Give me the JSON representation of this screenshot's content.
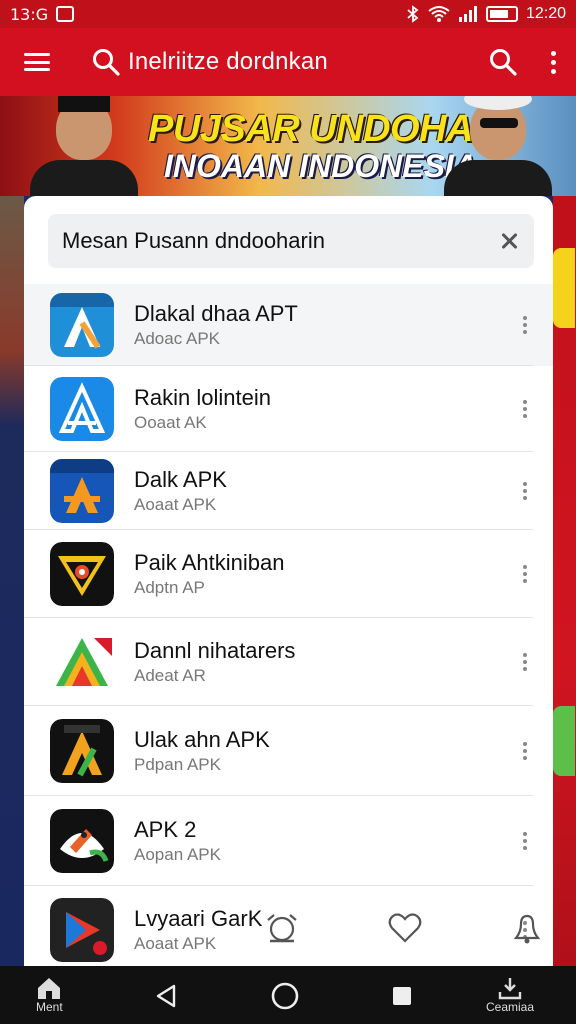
{
  "status_bar": {
    "time": "13:G",
    "clock": "12:20"
  },
  "app_bar": {
    "title": "Inelriitze dordnkan"
  },
  "banner": {
    "line1": "PUJSAR UNDOHAIN",
    "line2": "INOAAN INDONESIA"
  },
  "search": {
    "value": "Mesan Pusann dndooharin"
  },
  "apps": [
    {
      "name": "Dlakal dhaa APT",
      "sub": "Adoac APK",
      "icon": "blue-a-icon"
    },
    {
      "name": "Rakin lolintein",
      "sub": "Ooaat AK",
      "icon": "outline-a-icon"
    },
    {
      "name": "Dalk APK",
      "sub": "Aoaat APK",
      "icon": "orange-a-icon"
    },
    {
      "name": "Paik Ahtkiniban",
      "sub": "Adptn AP",
      "icon": "triangle-eye-icon"
    },
    {
      "name": "Dannl nihatarers",
      "sub": "Adeat AR",
      "icon": "rainbow-a-icon"
    },
    {
      "name": "Ulak ahn APK",
      "sub": "Pdpan APK",
      "icon": "dark-a-icon"
    },
    {
      "name": "APK 2",
      "sub": "Aopan APK",
      "icon": "rocket-icon"
    },
    {
      "name": "Lvyaari GarK",
      "sub": "Aoaat APK",
      "icon": "play-icon"
    }
  ],
  "nav": {
    "home_label": "Ment",
    "right_label": "Ceamiaa"
  },
  "colors": {
    "primary": "#d3101f",
    "status": "#c0101a"
  }
}
